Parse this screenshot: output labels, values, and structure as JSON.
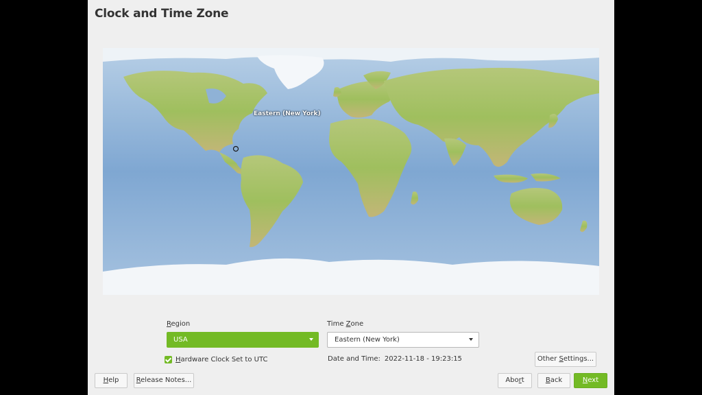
{
  "page": {
    "title": "Clock and Time Zone"
  },
  "icons": {
    "theme_toggle": "moon-icon",
    "checkbox": "checkmark-icon",
    "dropdown": "chevron-down-icon"
  },
  "colors": {
    "accent": "#73ba25",
    "window_bg": "#efefef",
    "screen_bg": "#000000"
  },
  "map": {
    "selected_zone_label": "Eastern (New York)"
  },
  "region": {
    "label": "Region",
    "mnemonic": "R",
    "label_rest": "egion",
    "value": "USA"
  },
  "timezone": {
    "label_pre": "Time ",
    "mnemonic": "Z",
    "label_rest": "one",
    "value": "Eastern (New York)"
  },
  "hwclock": {
    "label_pre": "",
    "mnemonic": "H",
    "label_rest": "ardware Clock Set to UTC",
    "checked": true
  },
  "datetime": {
    "label": "Date and Time:",
    "value": "2022-11-18 - 19:23:15"
  },
  "buttons": {
    "other_settings": {
      "pre": "Other ",
      "mnemonic": "S",
      "rest": "ettings..."
    },
    "help": {
      "pre": "",
      "mnemonic": "H",
      "rest": "elp"
    },
    "release_notes": {
      "pre": "",
      "mnemonic": "R",
      "rest": "elease Notes..."
    },
    "abort": {
      "pre": "Abo",
      "mnemonic": "r",
      "rest": "t"
    },
    "back": {
      "pre": "",
      "mnemonic": "B",
      "rest": "ack"
    },
    "next": {
      "pre": "",
      "mnemonic": "N",
      "rest": "ext"
    }
  }
}
